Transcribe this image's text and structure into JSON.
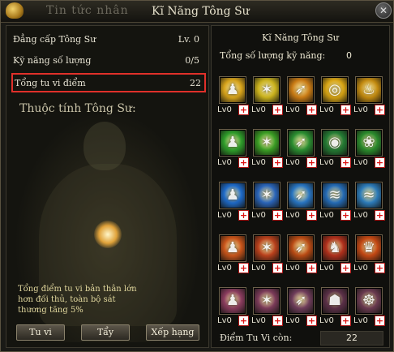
{
  "window": {
    "tab_inactive": "Tin tức nhân",
    "title": "Kĩ Năng Tông Sư",
    "close_icon": "close-icon"
  },
  "left": {
    "rows": [
      {
        "label": "Đẳng cấp Tông Sư",
        "value": "Lv. 0"
      },
      {
        "label": "Kỹ năng số lượng",
        "value": "0/5"
      },
      {
        "label": "Tổng tu vi điểm",
        "value": "22"
      }
    ],
    "attr_title": "Thuộc tính Tông Sư:",
    "note_lines": [
      "Tổng điểm tu vi bản thân lớn",
      "hơn đối thủ, toàn bộ sát",
      "thương tăng 5%"
    ],
    "buttons": [
      "Tu vi",
      "Tẩy",
      "Xếp hạng"
    ]
  },
  "right": {
    "title": "Kĩ Năng Tông Sư",
    "count_label": "Tổng số lượng kỹ năng:",
    "count_value": "0",
    "footer_label": "Điểm Tu Vi còn:",
    "footer_value": "22",
    "skills": [
      [
        {
          "lv": "Lv0",
          "icon": "warrior-icon",
          "color": "#d6a21a"
        },
        {
          "lv": "Lv0",
          "icon": "blade-burst-icon",
          "color": "#c8b01c"
        },
        {
          "lv": "Lv0",
          "icon": "arrow-strike-icon",
          "color": "#c87a14"
        },
        {
          "lv": "Lv0",
          "icon": "spiral-icon",
          "color": "#d9a514"
        },
        {
          "lv": "Lv0",
          "icon": "flame-fan-icon",
          "color": "#c28a10"
        }
      ],
      [
        {
          "lv": "Lv0",
          "icon": "warrior-icon",
          "color": "#2e9c2a"
        },
        {
          "lv": "Lv0",
          "icon": "blade-burst-icon",
          "color": "#3a9c24"
        },
        {
          "lv": "Lv0",
          "icon": "arrow-strike-icon",
          "color": "#2a8c30"
        },
        {
          "lv": "Lv0",
          "icon": "orb-ring-icon",
          "color": "#247c34"
        },
        {
          "lv": "Lv0",
          "icon": "lotus-icon",
          "color": "#2a8a2c"
        }
      ],
      [
        {
          "lv": "Lv0",
          "icon": "warrior-icon",
          "color": "#1e6ac8"
        },
        {
          "lv": "Lv0",
          "icon": "blade-burst-icon",
          "color": "#2a64b8"
        },
        {
          "lv": "Lv0",
          "icon": "arrow-strike-icon",
          "color": "#2874c0"
        },
        {
          "lv": "Lv0",
          "icon": "tornado-icon",
          "color": "#246ab4"
        },
        {
          "lv": "Lv0",
          "icon": "wave-icon",
          "color": "#2c7ab8"
        }
      ],
      [
        {
          "lv": "Lv0",
          "icon": "warrior-icon",
          "color": "#c8541a"
        },
        {
          "lv": "Lv0",
          "icon": "blade-burst-icon",
          "color": "#b8401c"
        },
        {
          "lv": "Lv0",
          "icon": "arrow-strike-icon",
          "color": "#b84a14"
        },
        {
          "lv": "Lv0",
          "icon": "demon-icon",
          "color": "#b0301c"
        },
        {
          "lv": "Lv0",
          "icon": "fire-crown-icon",
          "color": "#c44814"
        }
      ],
      [
        {
          "lv": "Lv0",
          "icon": "warrior-icon",
          "color": "#8a3c5e"
        },
        {
          "lv": "Lv0",
          "icon": "blade-burst-icon",
          "color": "#7a3a58"
        },
        {
          "lv": "Lv0",
          "icon": "arrow-strike-icon",
          "color": "#6e3c5a"
        },
        {
          "lv": "Lv0",
          "icon": "mask-icon",
          "color": "#5c3048"
        },
        {
          "lv": "Lv0",
          "icon": "sage-icon",
          "color": "#6a3a50"
        }
      ]
    ]
  }
}
